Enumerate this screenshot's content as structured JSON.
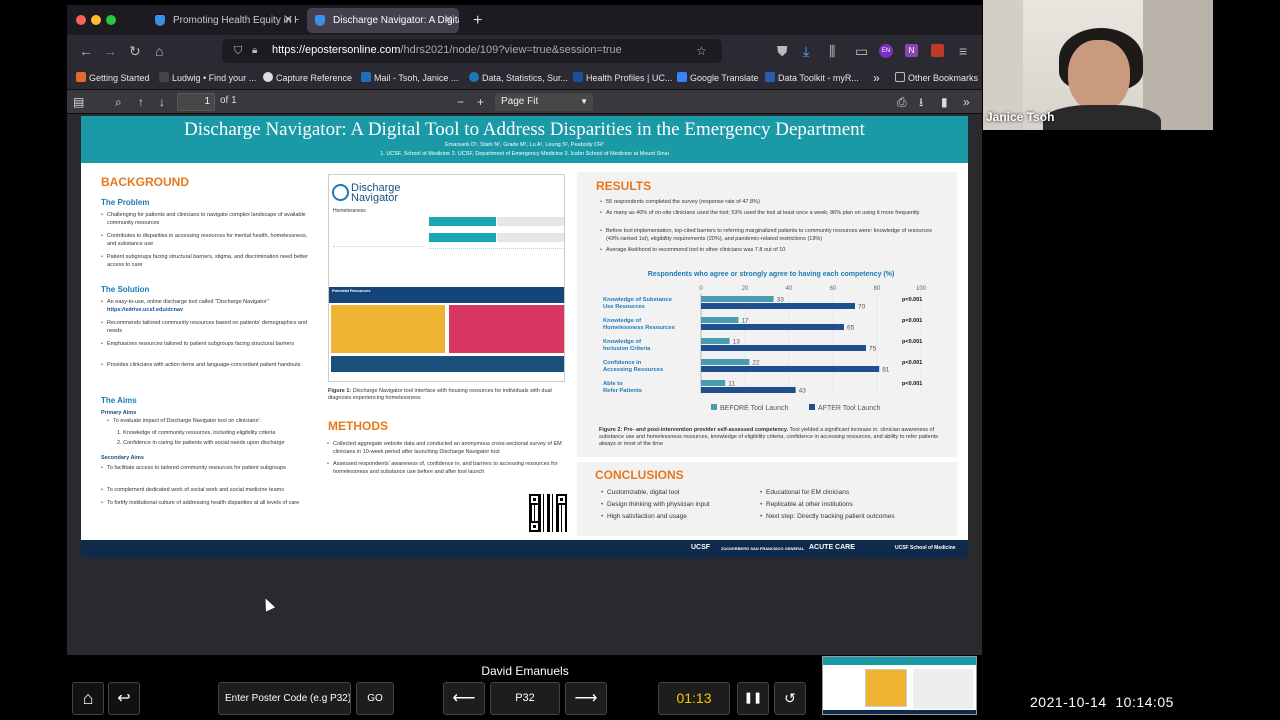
{
  "browser": {
    "tabs": [
      {
        "title": "Promoting Health Equity in Healt",
        "active": false
      },
      {
        "title": "Discharge Navigator: A Digital To",
        "active": true
      }
    ],
    "url_host": "https://epostersonline.com",
    "url_rest": "/hdrs2021/node/109?view=true&session=true",
    "bookmarks": [
      {
        "label": "Getting Started",
        "color": "#e8672a"
      },
      {
        "label": "Ludwig • Find your ...",
        "color": "#444444"
      },
      {
        "label": "Capture Reference",
        "color": "#dddddd"
      },
      {
        "label": "Mail - Tsoh, Janice ...",
        "color": "#1f6fc1"
      },
      {
        "label": "Data, Statistics, Sur...",
        "color": "#1a7ab8"
      },
      {
        "label": "Health Profiles | UC...",
        "color": "#1a4f9a"
      },
      {
        "label": "Google Translate",
        "color": "#3b82f6"
      },
      {
        "label": "Data Toolkit - myR...",
        "color": "#2a5db0"
      },
      {
        "label": "Other Bookmarks",
        "color": "#bbbbbb"
      }
    ]
  },
  "pdf": {
    "page_number": "1",
    "page_count": "of 1",
    "zoom": "Page Fit"
  },
  "poster": {
    "title": "Discharge Navigator: A Digital Tool to Address Disparities in the Emergency Department",
    "authors": "Emanuels D¹, Stark N², Grade M², Lu A¹, Leung S², Peabody CR²",
    "affiliations": "1. UCSF, School of Medicine  2. UCSF, Department of Emergency Medicine  3. Icahn School of Medicine at Mount Sinai",
    "background_heading": "BACKGROUND",
    "problem_heading": "The Problem",
    "problem_bullets": [
      "Challenging for patients and clinicians to navigate complex landscape of available community resources",
      "Contributes to disparities in accessing resources for mental health, homelessness, and substance use",
      "Patient subgroups facing structural barriers, stigma, and discrimination need better access to care"
    ],
    "solution_heading": "The Solution",
    "solution_bullets": [
      "An easy-to-use, online discharge tool called \"Discharge Navigator\"",
      "Recommends tailored community resources based on patients' demographics and needs",
      "Emphasizes resources tailored to patient subgroups facing structural barriers",
      "Provides clinicians with action items and language-concordant patient handouts"
    ],
    "solution_link": "https://edrive.ucsf.edu/dcnav",
    "aims_heading": "The Aims",
    "primary_aims_heading": "Primary Aims",
    "primary_aims": [
      "To evaluate impact of Discharge Navigator tool on clinicians':",
      "1. Knowledge of community resources, including eligibility criteria",
      "2. Confidence in caring for patients with social needs upon discharge"
    ],
    "secondary_aims_heading": "Secondary Aims",
    "secondary_aims": [
      "To facilitate access to tailored community resources for patient subgroups",
      "To complement dedicated work of social work and social medicine teams",
      "To fortify institutional culture of addressing health disparities at all levels of care"
    ],
    "fig1": {
      "logo_line1": "Discharge",
      "logo_line2": "Navigator",
      "section": "Homelessness",
      "potential_resources": "Potential Resources",
      "caption_bold": "Figure 1:",
      "caption": " Discharge Navigator tool interface with housing resources for individuals with dual diagnosis experiencing homelessness"
    },
    "methods_heading": "METHODS",
    "methods_bullets": [
      "Collected aggregate website data and conducted an anonymous cross-sectional survey of EM clinicians in 10-week period after launching Discharge Navigator tool",
      "Assessed respondents' awareness of, confidence in, and barriers to accessing resources for homelessness and substance use before and after tool launch"
    ],
    "results_heading": "RESULTS",
    "results_bullets": [
      "55 respondents completed the survey (response rate of 47.8%)",
      "As many as 40% of on-site clinicians used the tool; 53% used the tool at least once a week; 86% plan on using it more frequently",
      "Before tool implementation, top-cited barriers to referring marginalized patients to community resources were: knowledge of resources (43% ranked 1st), eligibility requirements (20%), and pandemic-related restrictions (19%)",
      "Average likelihood to recommend tool to other clinicians was 7.8 out of 10"
    ],
    "fig2_caption_bold": "Figure 2: Pre- and post-intervention provider self-assessed competency.",
    "fig2_caption": " Tool yielded a significant increase in: clinician awareness of substance use and homelessness resources, knowledge of eligibility criteria, confidence in accessing resources, and ability to refer patients always or most of the time",
    "conclusions_heading": "CONCLUSIONS",
    "conclusions_left": [
      "Customizable, digital tool",
      "Design thinking with physician input",
      "High satisfaction and usage"
    ],
    "conclusions_right": [
      "Educational for EM clinicians",
      "Replicable at other institutions",
      "Next step: Directly tracking patient outcomes"
    ],
    "footer_logos": [
      "UCSF",
      "ZUCKERBERG SAN FRANCISCO GENERAL",
      "ACUTE CARE",
      "UCSF School of Medicine"
    ]
  },
  "chart_data": {
    "type": "bar",
    "title": "Respondents who agree or strongly agree to having each competency (%)",
    "categories": [
      "Knowledge of Substance Use Resources",
      "Knowledge of Homelessness Resources",
      "Knowledge of Inclusion Criteria",
      "Confidence in Accessing Resources",
      "Able to Refer Patients"
    ],
    "series": [
      {
        "name": "BEFORE Tool Launch",
        "values": [
          33,
          17,
          13,
          22,
          11
        ],
        "color": "#4a9bb0"
      },
      {
        "name": "AFTER Tool Launch",
        "values": [
          70,
          65,
          75,
          81,
          43
        ],
        "color": "#1f4f8f"
      }
    ],
    "pvalues": [
      "p<0.001",
      "p<0.001",
      "p<0.001",
      "p<0.001",
      "p<0.001"
    ],
    "xlim": [
      0,
      100
    ],
    "xticks": [
      0,
      20,
      40,
      60,
      80,
      100
    ],
    "legend": "bottom"
  },
  "video": {
    "participant_name": "Janice Tsoh"
  },
  "controls": {
    "presenter_name": "David Emanuels",
    "poster_code_placeholder": "Enter Poster Code (e.g P32)",
    "go_label": "GO",
    "current_poster": "P32",
    "timer": "01:13"
  },
  "clock": "2021-10-14  10:14:05"
}
